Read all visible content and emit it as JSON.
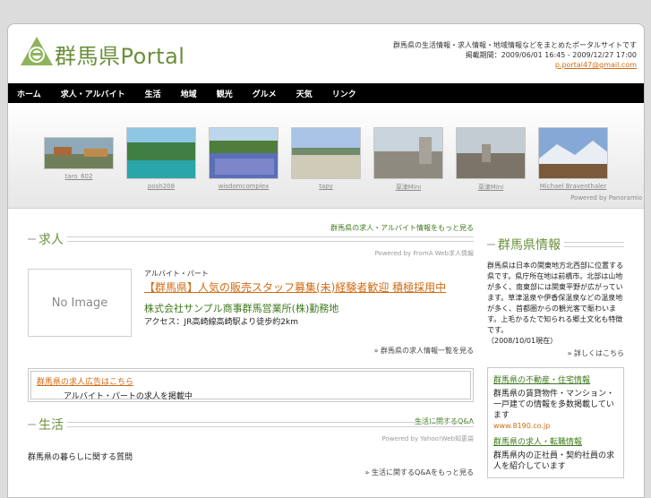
{
  "header": {
    "logo_text": "群馬県Portal",
    "info_line": "群馬県の生活情報・求人情報・地域情報などをまとめたポータルサイトです",
    "period": "掲載期間：2009/06/01 16:45 - 2009/12/27 17:00",
    "email": "p.portal47@gmail.com"
  },
  "nav": [
    "ホーム",
    "求人・アルバイト",
    "生活",
    "地域",
    "観光",
    "グルメ",
    "天気",
    "リンク"
  ],
  "gallery": {
    "photos": [
      {
        "caption": "taro_602"
      },
      {
        "caption": "posh208"
      },
      {
        "caption": "wisdomcomplex"
      },
      {
        "caption": "tapy"
      },
      {
        "caption": "草津Mini"
      },
      {
        "caption": "草津Mini"
      },
      {
        "caption": "Michael Braventhaler"
      }
    ],
    "powered": "Powered by Panoramio"
  },
  "kyujin": {
    "title": "求人",
    "link": "群馬県の求人・アルバイト情報をもっと見る",
    "powered": "Powered by FromA Web求人情報",
    "noimage": "No Image",
    "category": "アルバイト・パート",
    "job_title": "【群馬県】人気の販売スタッフ募集(未)経験者歓迎 積極採用中",
    "company": "株式会社サンプル商事群馬営業所(株)勤務地",
    "access": "アクセス：JR高崎線高崎駅より徒歩約2km",
    "more": "群馬県の求人情報一覧を見る"
  },
  "adbox": {
    "link": "群馬県の求人広告はこちら",
    "text": "アルバイト・パートの求人を掲載中"
  },
  "seikatsu": {
    "title": "生活",
    "link": "生活に関するQ&A",
    "powered": "Powered by Yahoo!Web知恵袋",
    "text": "群馬県の暮らしに関する質問",
    "more": "生活に関するQ&Aをもっと見る"
  },
  "sidebar": {
    "title": "群馬県情報",
    "text": "群馬県は日本の関東地方北西部に位置する県です。県庁所在地は前橋市。北部は山地が多く、南東部には関東平野が広がっています。草津温泉や伊香保温泉などの温泉地が多く、首都圏からの観光客で賑わいます。上毛かるたで知られる郷土文化も特徴です。",
    "date": "（2008/10/01現在）",
    "more": "詳しくはこちら",
    "ads": [
      {
        "link": "群馬県の不動産・住宅情報",
        "text": "群馬県の賃貸物件・マンション・一戸建ての情報を多数掲載しています",
        "url": "www.8190.co.jp"
      },
      {
        "link": "群馬県の求人・転職情報",
        "text": "群馬県内の正社員・契約社員の求人を紹介しています",
        "url": ""
      }
    ]
  },
  "colors": {
    "accent_green": "#6b8f3a",
    "link_orange": "#d26b12",
    "nav_bg": "#000000"
  }
}
